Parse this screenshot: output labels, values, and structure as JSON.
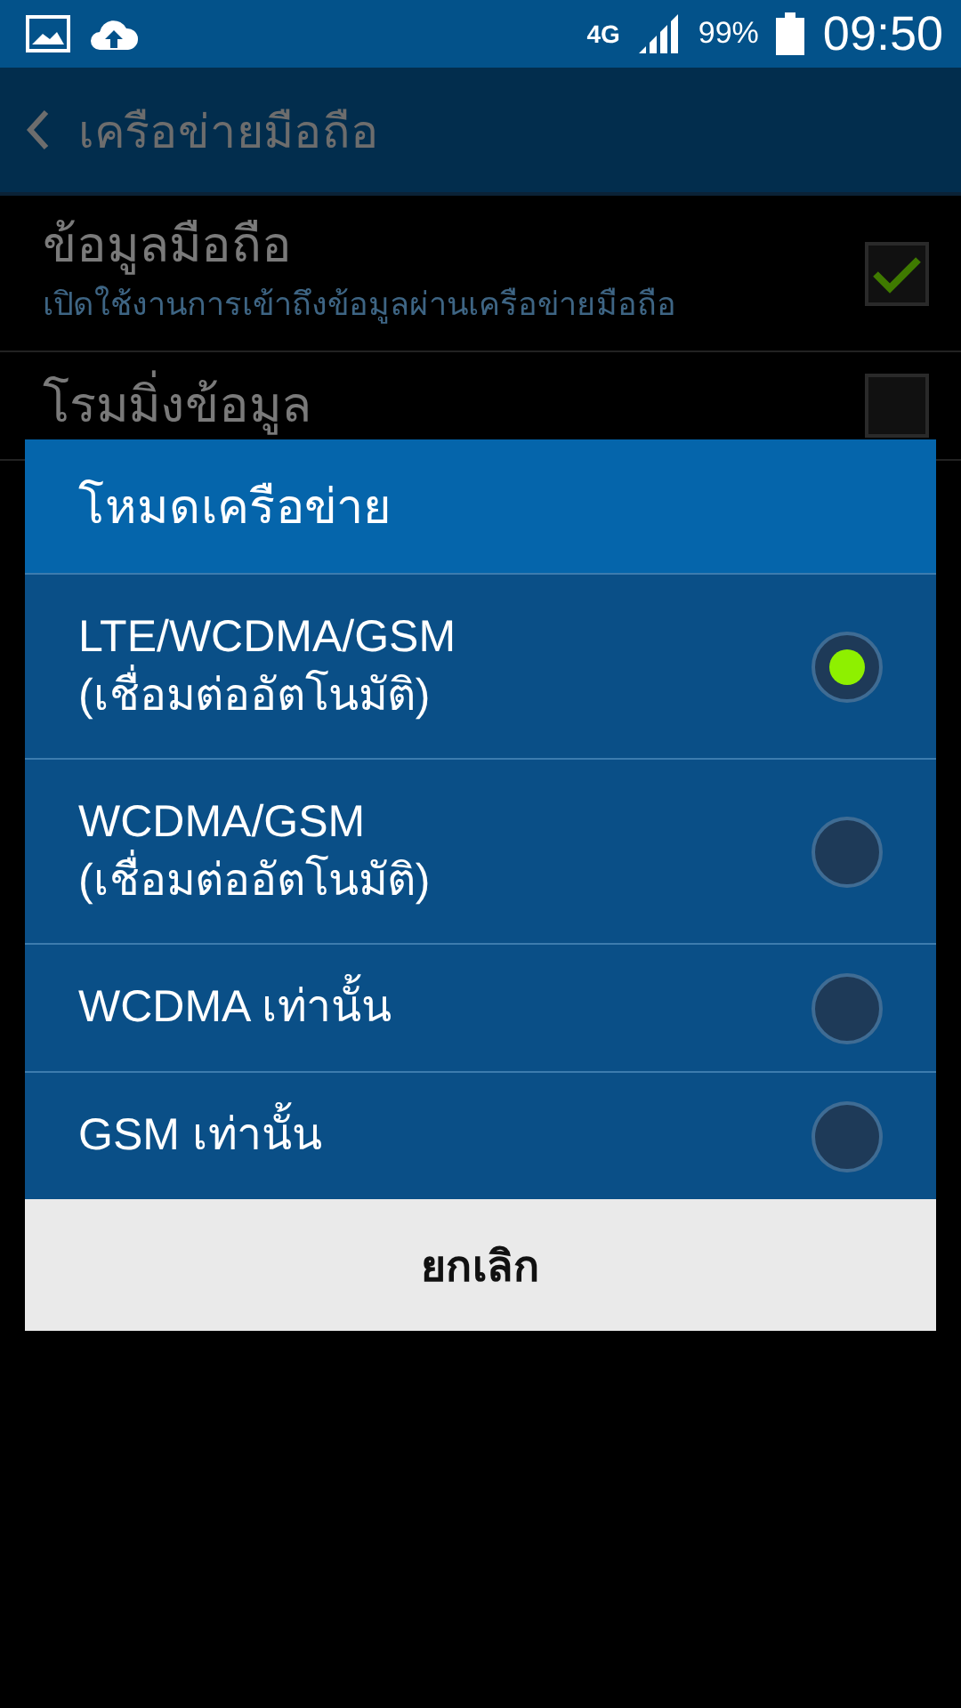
{
  "status_bar": {
    "network": "4G",
    "battery": "99%",
    "time": "09:50"
  },
  "header": {
    "title": "เครือข่ายมือถือ"
  },
  "settings": [
    {
      "title": "ข้อมูลมือถือ",
      "summary": "เปิดใช้งานการเข้าถึงข้อมูลผ่านเครือข่ายมือถือ",
      "checked": true
    },
    {
      "title": "โรมมิ่งข้อมูล",
      "checked": false
    }
  ],
  "dialog": {
    "title": "โหมดเครือข่าย",
    "options": [
      {
        "label": "LTE/WCDMA/GSM\n(เชื่อมต่ออัตโนมัติ)",
        "selected": true
      },
      {
        "label": "WCDMA/GSM\n(เชื่อมต่ออัตโนมัติ)",
        "selected": false
      },
      {
        "label": "WCDMA เท่านั้น",
        "selected": false
      },
      {
        "label": "GSM เท่านั้น",
        "selected": false
      }
    ],
    "cancel": "ยกเลิก"
  }
}
